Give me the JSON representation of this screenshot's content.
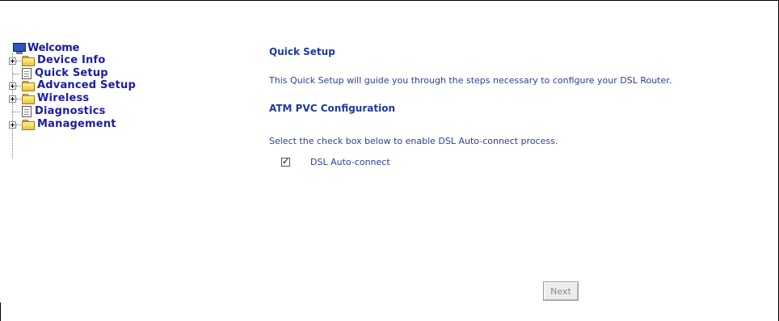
{
  "nav": {
    "root": "Welcome",
    "items": [
      {
        "label": "Device Info",
        "icon": "folder-icon",
        "expandable": true
      },
      {
        "label": "Quick Setup",
        "icon": "page-icon",
        "expandable": false
      },
      {
        "label": "Advanced Setup",
        "icon": "folder-icon",
        "expandable": true
      },
      {
        "label": "Wireless",
        "icon": "folder-icon",
        "expandable": true
      },
      {
        "label": "Diagnostics",
        "icon": "page-icon",
        "expandable": false
      },
      {
        "label": "Management",
        "icon": "folder-icon",
        "expandable": true
      }
    ]
  },
  "main": {
    "title": "Quick Setup",
    "intro": "This Quick Setup will guide you through the steps necessary to configure your DSL Router.",
    "section_title": "ATM PVC Configuration",
    "instruction": "Select the check box below to enable DSL Auto-connect process.",
    "auto_connect": {
      "label": "DSL Auto-connect",
      "checked": true,
      "check_glyph": "✓"
    },
    "next_label": "Next"
  },
  "colors": {
    "nav_text": "#1c1ca8",
    "heading": "#1c3a9c",
    "body_text": "#2a3f9a"
  }
}
